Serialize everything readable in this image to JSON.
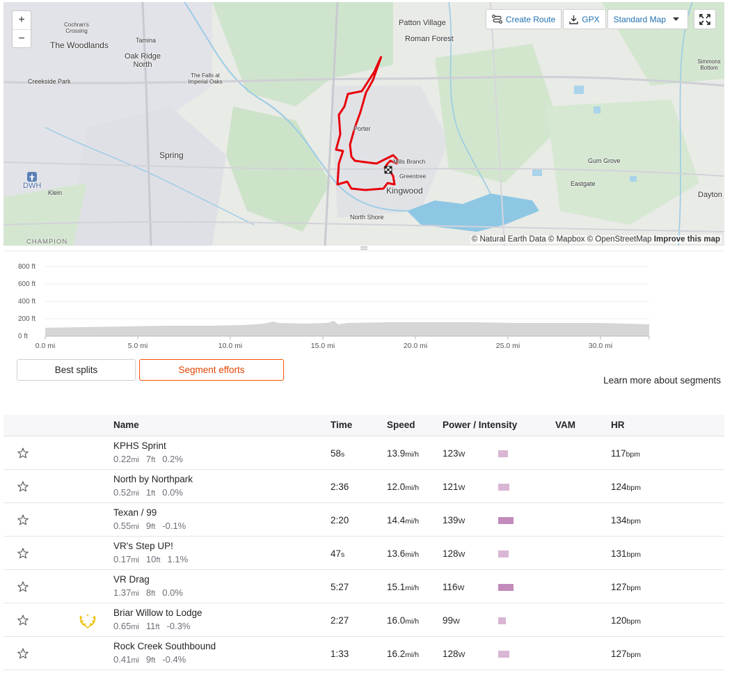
{
  "map": {
    "zoom_in": "+",
    "zoom_out": "−",
    "labels": {
      "the_woodlands": "The Woodlands",
      "cochrans_crossing": "Cochran's Crossing",
      "tamina": "Tamina",
      "oak_ridge_north": "Oak Ridge North",
      "creekside_park": "Creekside Park",
      "falls_imperial_oaks": "The Falls at Imperial Oaks",
      "spring": "Spring",
      "dwh": "DWH",
      "klein": "Klein",
      "champion": "CHAMPION",
      "patton_village": "Patton Village",
      "roman_forest": "Roman Forest",
      "porter": "Porter",
      "mills_branch": "Mills Branch",
      "greentree": "Greentree",
      "kingwood": "Kingwood",
      "north_shore": "North Shore",
      "gum_grove": "Gum Grove",
      "eastgate": "Eastgate",
      "dayton": "Dayton",
      "simmons_bottom": "Simmons Bottom"
    },
    "toolbar": {
      "create_route": "Create Route",
      "gpx": "GPX",
      "map_style": "Standard Map"
    },
    "attribution": {
      "natural_earth": "© Natural Earth Data",
      "mapbox": "© Mapbox",
      "osm": "© OpenStreetMap",
      "improve": "Improve this map"
    },
    "route_color": "#e8000b"
  },
  "elevation": {
    "y_ticks": [
      "800 ft",
      "600 ft",
      "400 ft",
      "200 ft",
      "0 ft"
    ],
    "x_ticks": [
      "0.0 mi",
      "5.0 mi",
      "10.0 mi",
      "15.0 mi",
      "20.0 mi",
      "25.0 mi",
      "30.0 mi"
    ]
  },
  "tabs": {
    "best_splits": "Best splits",
    "segment_efforts": "Segment efforts",
    "active": "segment_efforts"
  },
  "learn_more": "Learn more about segments",
  "table": {
    "headers": {
      "name": "Name",
      "time": "Time",
      "speed": "Speed",
      "power": "Power / Intensity",
      "vam": "VAM",
      "hr": "HR"
    },
    "rows": [
      {
        "name": "KPHS Sprint",
        "dist": "0.22",
        "dist_unit": "mi",
        "elev": "7",
        "elev_unit": "ft",
        "grade": "0.2%",
        "time": "58",
        "time_unit": "s",
        "speed": "13.9",
        "speed_unit": "mi/h",
        "power": "123",
        "power_unit": "W",
        "intensity": 0.35,
        "hr": "117",
        "hr_unit": "bpm",
        "crown": false
      },
      {
        "name": "North by Northpark",
        "dist": "0.52",
        "dist_unit": "mi",
        "elev": "1",
        "elev_unit": "ft",
        "grade": "0.0%",
        "time": "2:36",
        "time_unit": "",
        "speed": "12.0",
        "speed_unit": "mi/h",
        "power": "121",
        "power_unit": "W",
        "intensity": 0.4,
        "hr": "124",
        "hr_unit": "bpm",
        "crown": false
      },
      {
        "name": "Texan / 99",
        "dist": "0.55",
        "dist_unit": "mi",
        "elev": "9",
        "elev_unit": "ft",
        "grade": "-0.1%",
        "time": "2:20",
        "time_unit": "",
        "speed": "14.4",
        "speed_unit": "mi/h",
        "power": "139",
        "power_unit": "W",
        "intensity": 0.55,
        "hr": "134",
        "hr_unit": "bpm",
        "crown": false
      },
      {
        "name": "VR's Step UP!",
        "dist": "0.17",
        "dist_unit": "mi",
        "elev": "10",
        "elev_unit": "ft",
        "grade": "1.1%",
        "time": "47",
        "time_unit": "s",
        "speed": "13.6",
        "speed_unit": "mi/h",
        "power": "128",
        "power_unit": "W",
        "intensity": 0.38,
        "hr": "131",
        "hr_unit": "bpm",
        "crown": false
      },
      {
        "name": "VR Drag",
        "dist": "1.37",
        "dist_unit": "mi",
        "elev": "8",
        "elev_unit": "ft",
        "grade": "0.0%",
        "time": "5:27",
        "time_unit": "",
        "speed": "15.1",
        "speed_unit": "mi/h",
        "power": "116",
        "power_unit": "W",
        "intensity": 0.55,
        "hr": "127",
        "hr_unit": "bpm",
        "crown": false
      },
      {
        "name": "Briar Willow to Lodge",
        "dist": "0.65",
        "dist_unit": "mi",
        "elev": "11",
        "elev_unit": "ft",
        "grade": "-0.3%",
        "time": "2:27",
        "time_unit": "",
        "speed": "16.0",
        "speed_unit": "mi/h",
        "power": "99",
        "power_unit": "W",
        "intensity": 0.28,
        "hr": "120",
        "hr_unit": "bpm",
        "crown": true
      },
      {
        "name": "Rock Creek Southbound",
        "dist": "0.41",
        "dist_unit": "mi",
        "elev": "9",
        "elev_unit": "ft",
        "grade": "-0.4%",
        "time": "1:33",
        "time_unit": "",
        "speed": "16.2",
        "speed_unit": "mi/h",
        "power": "128",
        "power_unit": "W",
        "intensity": 0.4,
        "hr": "127",
        "hr_unit": "bpm",
        "crown": false
      }
    ]
  },
  "colors": {
    "accent": "#fc5200",
    "link": "#1f6faf",
    "intensity": "#d9b6d3",
    "intensity_strong": "#c28bbb",
    "crown": "#f0c419"
  }
}
